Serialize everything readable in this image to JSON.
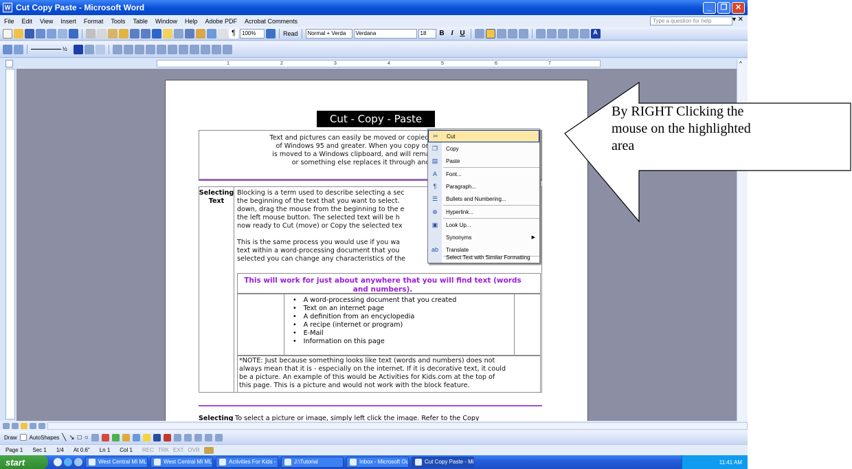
{
  "window": {
    "title": "Cut Copy Paste - Microsoft Word",
    "app_icon": "W"
  },
  "menubar": {
    "items": [
      "File",
      "Edit",
      "View",
      "Insert",
      "Format",
      "Tools",
      "Table",
      "Window",
      "Help",
      "Adobe PDF",
      "Acrobat Comments"
    ],
    "help_placeholder": "Type a question for help"
  },
  "toolbar": {
    "zoom": "100%",
    "read_label": "Read",
    "style": "Normal + Verda",
    "font": "Verdana",
    "font_size": "18",
    "bold": "B",
    "italic": "I",
    "underline": "U"
  },
  "ruler": {
    "marks": [
      "1",
      "2",
      "3",
      "4",
      "5",
      "6",
      "7"
    ]
  },
  "document": {
    "heading": "Cut - Copy - Paste",
    "intro_lines": [
      "Text and pictures can easily be moved or copied from one ap",
      "of Windows 95 and greater.   When you copy or cut text or",
      "is moved to a Windows clipboard, and will remain there unt",
      "or something else replaces it through another c"
    ],
    "selecting_label": [
      "Selecting",
      "Text"
    ],
    "selecting_text": [
      "Blocking is a term used to describe selecting a sec",
      "the beginning of the text that you want to select.",
      "down, drag the mouse from the beginning to the e",
      "the left mouse button.  The selected text will be h",
      "now ready to Cut (move) or Copy the selected tex",
      "",
      "This is the same process you would use if you wa",
      "text within a word-processing document that you",
      "selected you can change any characteristics of the"
    ],
    "purple_note": "This will work for just about anywhere that you will find text (words and numbers).",
    "bullets": [
      "A word-processing document that you created",
      "Text on an internet page",
      "A definition from an encyclopedia",
      "A recipe (internet or program)",
      "E-Mail",
      "Information on this page"
    ],
    "note_lines": [
      "*NOTE:  Just because something looks like text (words and numbers) does not",
      "always mean that it is - especially on the internet. If it is decorative text, it could",
      "be a picture.  An example of this would be Activities for Kids.com at the top of",
      "this page.  This is a picture and would not work with the block feature."
    ],
    "bottom_label": "Selecting",
    "bottom_text": "To select a picture or image, simply left click the image.   Refer to the Copy"
  },
  "context_menu": {
    "items": [
      {
        "label": "Cut",
        "icon": "scissors-icon"
      },
      {
        "label": "Copy",
        "icon": "copy-icon"
      },
      {
        "label": "Paste",
        "icon": "paste-icon"
      },
      {
        "label": "Font...",
        "icon": "font-icon"
      },
      {
        "label": "Paragraph...",
        "icon": "paragraph-icon"
      },
      {
        "label": "Bullets and Numbering...",
        "icon": "bullets-icon"
      },
      {
        "label": "Hyperlink...",
        "icon": "hyperlink-icon"
      },
      {
        "label": "Look Up...",
        "icon": "lookup-icon"
      },
      {
        "label": "Synonyms",
        "icon": ""
      },
      {
        "label": "Translate",
        "icon": "translate-icon"
      },
      {
        "label": "Select Text with Similar Formatting",
        "icon": ""
      }
    ]
  },
  "drawbar": {
    "draw": "Draw",
    "autoshapes": "AutoShapes"
  },
  "statusbar": {
    "page": "Page 1",
    "sec": "Sec 1",
    "pages": "1/4",
    "at": "At 0.6\"",
    "ln": "Ln 1",
    "col": "Col 1",
    "modes": [
      "REC",
      "TRK",
      "EXT",
      "OVR"
    ]
  },
  "taskbar": {
    "start": "start",
    "tasks": [
      "West Central MI MLS ...",
      "West Central MI MLS ...",
      "Activities For Kids - C...",
      "J:\\Tutorial",
      "Inbox - Microsoft Out...",
      "Cut Copy Paste - Micr..."
    ],
    "clock": "11:41 AM"
  },
  "callout": {
    "text": "By RIGHT Clicking the mouse on the highlighted area"
  },
  "colors": {
    "title_blue": "#0a4fd6",
    "purple": "#9b1fd8",
    "highlight": "#ffe8a6",
    "taskbar": "#245edc",
    "start_green": "#3a9a3a"
  }
}
